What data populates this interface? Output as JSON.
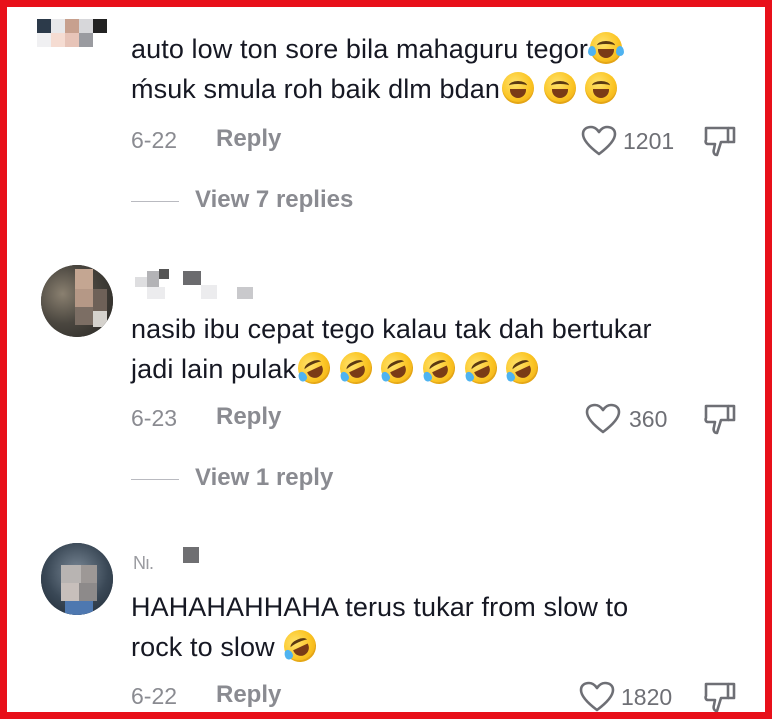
{
  "comments": [
    {
      "line1": "auto low ton sore bila mahaguru tegor",
      "line2": "ḿsuk smula roh baik dlm bdan",
      "date": "6-22",
      "reply_label": "Reply",
      "likes": "1201",
      "view_replies": "View 7 replies",
      "emojis_line1": [
        "face-with-tears-of-joy"
      ],
      "emojis_line2": [
        "grinning-squinting-face",
        "grinning-squinting-face",
        "grinning-squinting-face"
      ]
    },
    {
      "line1": "nasib ibu cepat tego kalau tak dah bertukar",
      "line2": "jadi lain pulak",
      "date": "6-23",
      "reply_label": "Reply",
      "likes": "360",
      "view_replies": "View 1 reply",
      "emojis_line2": [
        "rolling-on-floor-laughing",
        "rolling-on-floor-laughing",
        "rolling-on-floor-laughing",
        "rolling-on-floor-laughing",
        "rolling-on-floor-laughing",
        "rolling-on-floor-laughing"
      ]
    },
    {
      "username_fragment": "Nı.",
      "line1": "HAHAHAHHAHA terus tukar from slow to",
      "line2": "rock to slow",
      "date": "6-22",
      "reply_label": "Reply",
      "likes": "1820",
      "emojis_line2": [
        "rolling-on-floor-laughing"
      ]
    }
  ],
  "colors": {
    "border": "#e8101a",
    "text": "#161823",
    "meta": "#8a8b91"
  },
  "icons": [
    "heart-icon",
    "dislike-icon"
  ]
}
